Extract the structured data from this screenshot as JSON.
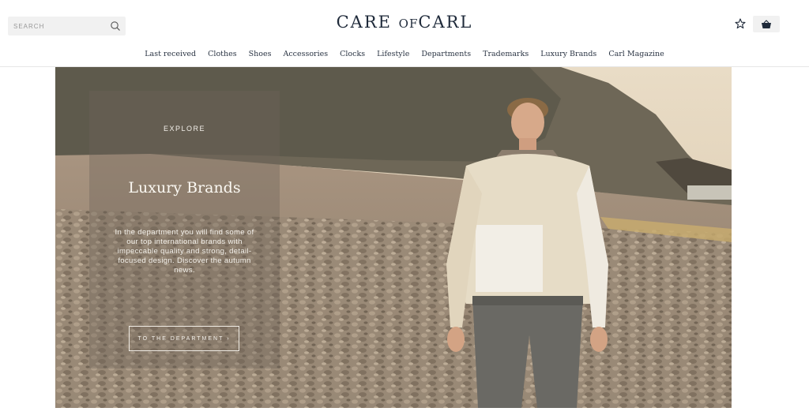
{
  "header": {
    "search_placeholder": "SEARCH",
    "logo_left": "CARE",
    "logo_mid": "OF",
    "logo_right": "CARL"
  },
  "nav": {
    "items": [
      "Last received",
      "Clothes",
      "Shoes",
      "Accessories",
      "Clocks",
      "Lifestyle",
      "Departments",
      "Trademarks",
      "Luxury Brands",
      "Carl Magazine"
    ]
  },
  "hero": {
    "eyebrow": "EXPLORE",
    "title": "Luxury Brands",
    "body": "In the department you will find some of our top international brands with impeccable quality and strong, detail-focused design. Discover the autumn news.",
    "cta": "TO THE DEPARTMENT ›"
  },
  "colors": {
    "brand_navy": "#1f2a3a",
    "search_bg": "#f1f1f1"
  }
}
